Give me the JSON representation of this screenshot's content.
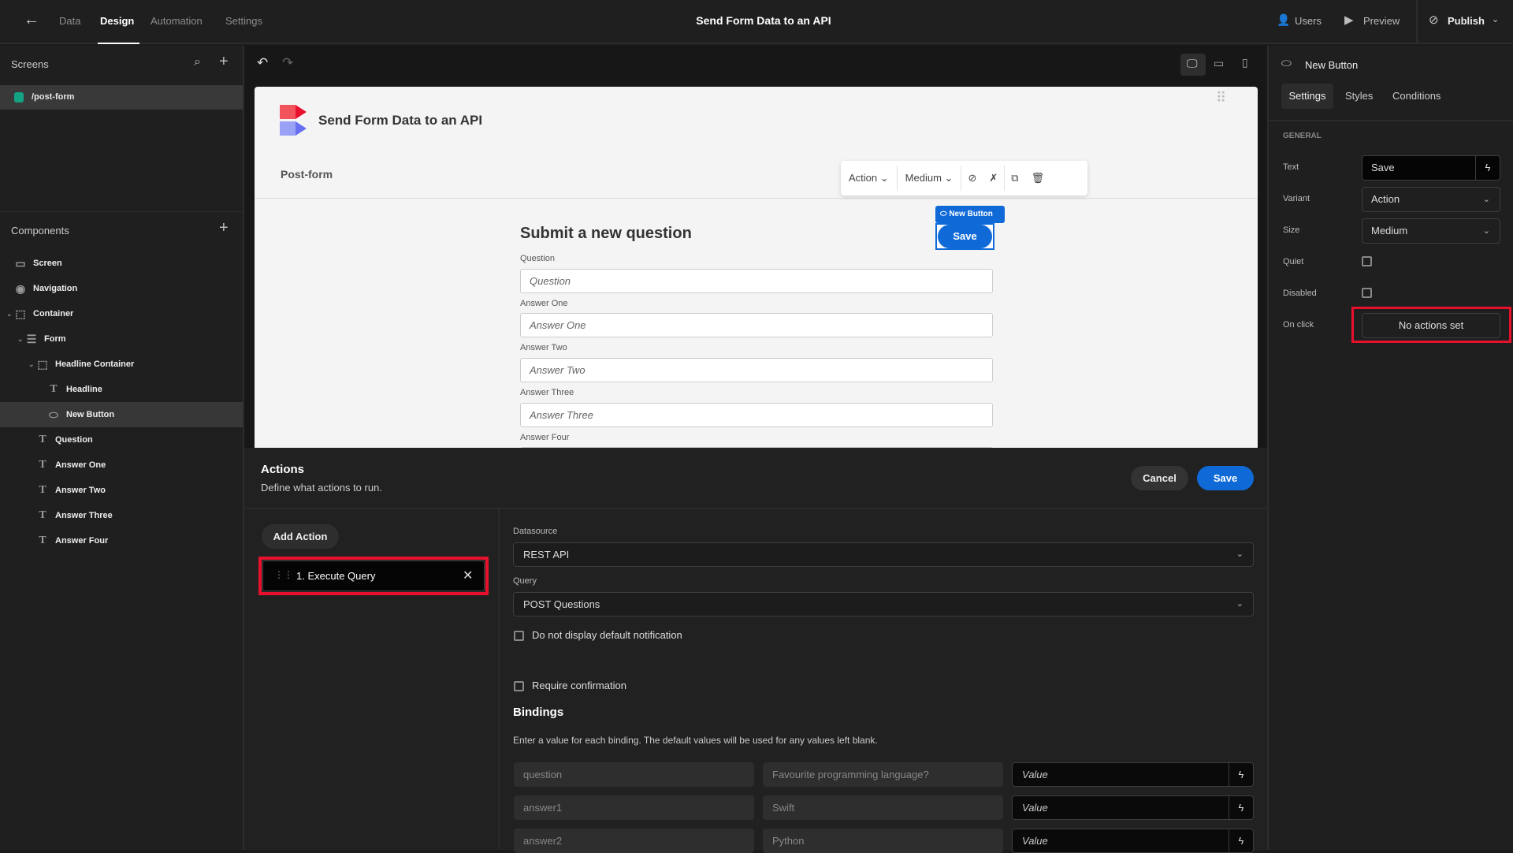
{
  "topbar": {
    "tabs": [
      "Data",
      "Design",
      "Automation",
      "Settings"
    ],
    "active_tab": "Design",
    "title": "Send Form Data to an API",
    "users": "Users",
    "preview": "Preview",
    "publish": "Publish"
  },
  "screens": {
    "header": "Screens",
    "items": [
      {
        "label": "/post-form",
        "color": "#12a383"
      }
    ]
  },
  "components": {
    "header": "Components",
    "items": [
      "Screen",
      "Navigation",
      "Container",
      "Form",
      "Headline Container",
      "Headline",
      "New Button",
      "Question",
      "Answer One",
      "Answer Two",
      "Answer Three",
      "Answer Four"
    ],
    "selected": "New Button"
  },
  "preview": {
    "app_title": "Send Form Data to an API",
    "nav_label": "Post-form",
    "toolbar": {
      "variant": "Action",
      "size": "Medium"
    },
    "component_tag": "New Button",
    "button_text": "Save",
    "form_heading": "Submit a new question",
    "fields": [
      {
        "label": "Question",
        "placeholder": "Question"
      },
      {
        "label": "Answer One",
        "placeholder": "Answer One"
      },
      {
        "label": "Answer Two",
        "placeholder": "Answer Two"
      },
      {
        "label": "Answer Three",
        "placeholder": "Answer Three"
      },
      {
        "label": "Answer Four",
        "placeholder": ""
      }
    ]
  },
  "settings_panel": {
    "component": "New Button",
    "tabs": [
      "Settings",
      "Styles",
      "Conditions"
    ],
    "active_tab": "Settings",
    "section": "GENERAL",
    "labels": {
      "text": "Text",
      "variant": "Variant",
      "size": "Size",
      "quiet": "Quiet",
      "disabled": "Disabled",
      "onclick": "On click"
    },
    "values": {
      "text": "Save",
      "variant": "Action",
      "size": "Medium",
      "quiet": false,
      "disabled": false,
      "onclick": "No actions set"
    },
    "highlight_color": "#e8112d"
  },
  "actions": {
    "title": "Actions",
    "subtitle": "Define what actions to run.",
    "cancel": "Cancel",
    "save": "Save",
    "add_action": "Add Action",
    "list": [
      "1. Execute Query"
    ],
    "datasource_label": "Datasource",
    "datasource": "REST API",
    "query_label": "Query",
    "query": "POST Questions",
    "no_notification": "Do not display default notification",
    "require_confirmation": "Require confirmation",
    "bindings_title": "Bindings",
    "bindings_desc": "Enter a value for each binding. The default values will be used for any values left blank.",
    "bindings": [
      {
        "name": "question",
        "default": "Favourite programming language?",
        "value_placeholder": "Value"
      },
      {
        "name": "answer1",
        "default": "Swift",
        "value_placeholder": "Value"
      },
      {
        "name": "answer2",
        "default": "Python",
        "value_placeholder": "Value"
      }
    ]
  },
  "accent": "#0f6ad8"
}
